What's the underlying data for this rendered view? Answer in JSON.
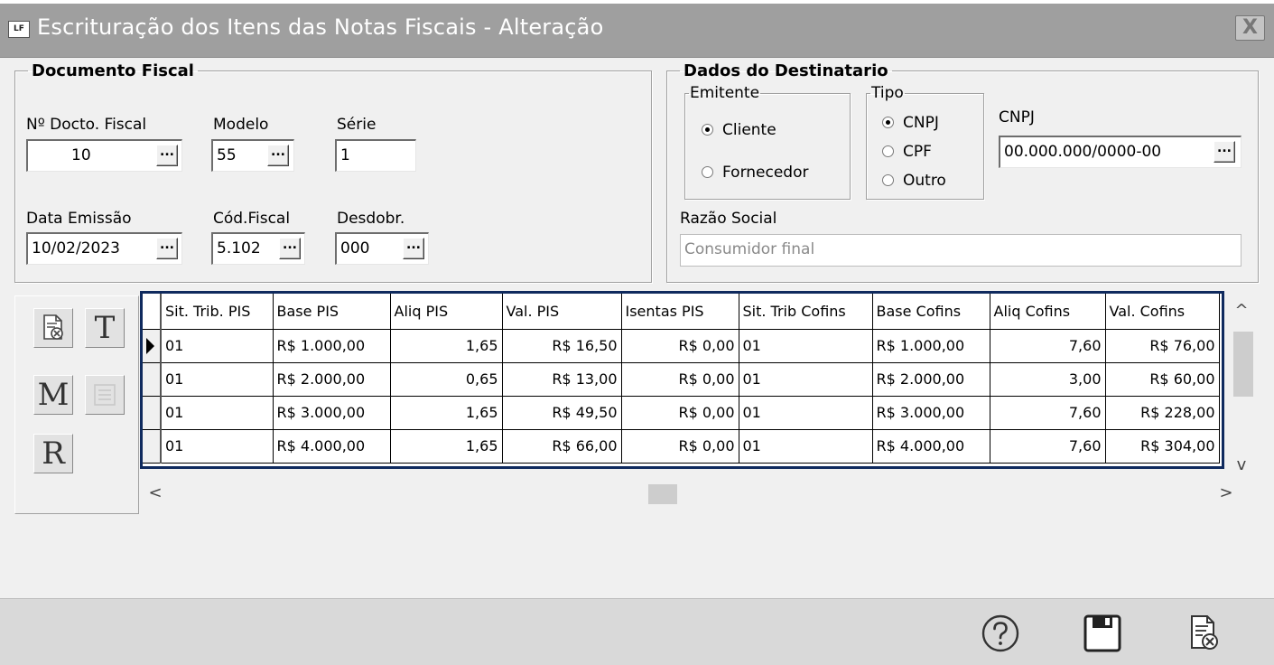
{
  "window": {
    "icon_text": "LF",
    "title": "Escrituração dos Itens das Notas Fiscais - Alteração",
    "close_symbol": "X"
  },
  "documento_fiscal": {
    "legend": "Documento Fiscal",
    "numero_label": "Nº Docto. Fiscal",
    "numero_value": "10",
    "modelo_label": "Modelo",
    "modelo_value": "55",
    "serie_label": "Série",
    "serie_value": "1",
    "data_label": "Data Emissão",
    "data_value": "10/02/2023",
    "cod_fiscal_label": "Cód.Fiscal",
    "cod_fiscal_value": "5.102",
    "desdobr_label": "Desdobr.",
    "desdobr_value": "000",
    "ellipsis": "..."
  },
  "destinatario": {
    "legend": "Dados do Destinatario",
    "emitente_legend": "Emitente",
    "cliente": "Cliente",
    "fornecedor": "Fornecedor",
    "emitente_selected": "Cliente",
    "tipo_legend": "Tipo",
    "cnpj_opt": "CNPJ",
    "cpf_opt": "CPF",
    "outro_opt": "Outro",
    "tipo_selected": "CNPJ",
    "cnpj_label": "CNPJ",
    "cnpj_value": "00.000.000/0000-00",
    "razao_label": "Razão Social",
    "razao_value": "Consumidor final"
  },
  "tools": {
    "t_label": "T",
    "m_label": "M",
    "r_label": "R"
  },
  "grid": {
    "columns": [
      "Sit. Trib. PIS",
      "Base PIS",
      "Aliq PIS",
      "Val. PIS",
      "Isentas PIS",
      "Sit. Trib Cofins",
      "Base Cofins",
      "Aliq Cofins",
      "Val. Cofins"
    ],
    "rows": [
      [
        "01",
        "R$ 1.000,00",
        "1,65",
        "R$ 16,50",
        "R$ 0,00",
        "01",
        "R$ 1.000,00",
        "7,60",
        "R$ 76,00"
      ],
      [
        "01",
        "R$ 2.000,00",
        "0,65",
        "R$ 13,00",
        "R$ 0,00",
        "01",
        "R$ 2.000,00",
        "3,00",
        "R$ 60,00"
      ],
      [
        "01",
        "R$ 3.000,00",
        "1,65",
        "R$ 49,50",
        "R$ 0,00",
        "01",
        "R$ 3.000,00",
        "7,60",
        "R$ 228,00"
      ],
      [
        "01",
        "R$ 4.000,00",
        "1,65",
        "R$ 66,00",
        "R$ 0,00",
        "01",
        "R$ 4.000,00",
        "7,60",
        "R$ 304,00"
      ]
    ],
    "selected_row": 0
  },
  "scroll": {
    "up": "^",
    "down": "v",
    "left": "<",
    "right": ">"
  },
  "footer": {
    "help_icon": "help-icon",
    "save_icon": "save-icon",
    "cancel_icon": "cancel-document-icon"
  },
  "colors": {
    "titlebar": "#9f9f9f",
    "grid_border": "#0f2a5e",
    "footer": "#d9d9d9"
  }
}
